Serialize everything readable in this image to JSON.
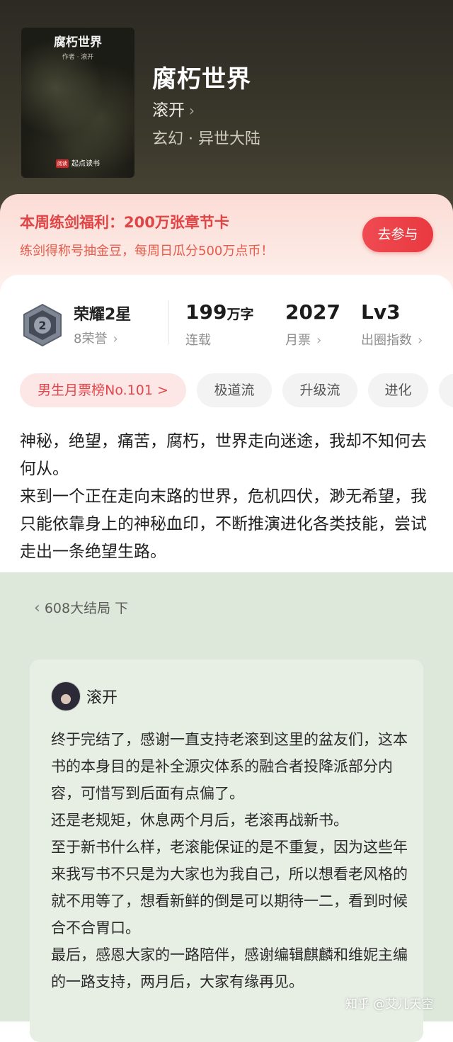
{
  "book": {
    "cover_title": "腐朽世界",
    "cover_author": "作者 · 滚开",
    "cover_brand_logo": "阅读",
    "cover_brand": "起点读书",
    "title": "腐朽世界",
    "author": "滚开",
    "genre": "玄幻 · 异世大陆"
  },
  "promo": {
    "title": "本周练剑福利：200万张章节卡",
    "subtitle": "练剑得称号抽金豆，每周日瓜分500万点币！",
    "button": "去参与"
  },
  "stats": {
    "honor": {
      "badge_level": "2",
      "label": "荣耀2星",
      "sub": "8荣誉"
    },
    "words": {
      "value": "199",
      "unit": "万字",
      "sub": "连载"
    },
    "monthly": {
      "value": "2027",
      "sub": "月票"
    },
    "level": {
      "value": "Lv3",
      "sub": "出圈指数"
    }
  },
  "tags": [
    "男生月票榜No.101 >",
    "极道流",
    "升级流",
    "进化",
    ""
  ],
  "description": [
    "神秘，绝望，痛苦，腐朽，世界走向迷途，我却不知何去何从。",
    "来到一个正在走向末路的世界，危机四伏，渺无希望，我只能依靠身上的神秘血印，不断推演进化各类技能，尝试走出一条绝望生路。"
  ],
  "chapter": {
    "label": "608大结局 下"
  },
  "post": {
    "author": "滚开",
    "paragraphs": [
      "终于完结了，感谢一直支持老滚到这里的盆友们，这本书的本身目的是补全源灾体系的融合者投降派部分内容，可惜写到后面有点偏了。",
      "还是老规矩，休息两个月后，老滚再战新书。",
      "至于新书什么样，老滚能保证的是不重复，因为这些年来我写书不只是为大家也为我自己，所以想看老风格的就不用等了，想看新鲜的倒是可以期待一二，看到时候合不合胃口。",
      "最后，感恩大家的一路陪伴，感谢编辑麒麟和维妮主编的一路支持，两月后，大家有缘再见。"
    ]
  },
  "watermark": "知乎 @艾儿天空",
  "colors": {
    "accent_red": "#e8393f",
    "promo_bg": "#fde8e3",
    "green_bg": "#dde8da"
  }
}
